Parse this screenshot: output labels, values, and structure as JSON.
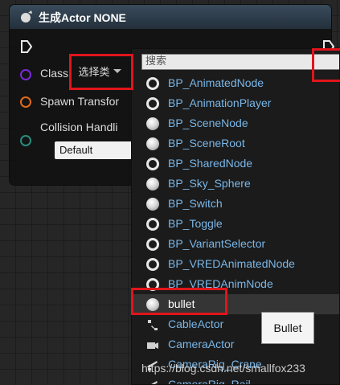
{
  "node": {
    "title": "生成Actor NONE",
    "pins": {
      "class_label": "Class",
      "class_combo_value": "选择类",
      "spawn_transform_label": "Spawn Transfor",
      "collision_label": "Collision Handli",
      "collision_value": "Default"
    }
  },
  "picker": {
    "search_placeholder": "搜索",
    "items": [
      {
        "label": "BP_AnimatedNode",
        "icon": "ring-icon"
      },
      {
        "label": "BP_AnimationPlayer",
        "icon": "ring-icon"
      },
      {
        "label": "BP_SceneNode",
        "icon": "ball-icon"
      },
      {
        "label": "BP_SceneRoot",
        "icon": "ball-icon"
      },
      {
        "label": "BP_SharedNode",
        "icon": "ring-icon"
      },
      {
        "label": "BP_Sky_Sphere",
        "icon": "ball-icon"
      },
      {
        "label": "BP_Switch",
        "icon": "ball-icon"
      },
      {
        "label": "BP_Toggle",
        "icon": "ring-icon"
      },
      {
        "label": "BP_VariantSelector",
        "icon": "ring-icon"
      },
      {
        "label": "BP_VREDAnimatedNode",
        "icon": "ring-icon"
      },
      {
        "label": "BP_VREDAnimNode",
        "icon": "ring-icon"
      },
      {
        "label": "bullet",
        "icon": "ball-icon",
        "selected": true
      },
      {
        "label": "CableActor",
        "icon": "cable-icon"
      },
      {
        "label": "CameraActor",
        "icon": "camera-icon"
      },
      {
        "label": "CameraRig_Crane",
        "icon": "crane-icon"
      },
      {
        "label": "CameraRig_Rail",
        "icon": "rail-icon"
      }
    ]
  },
  "tooltip": "Bullet",
  "watermark": "https://blog.csdn.net/smallfox233",
  "colors": {
    "highlight": "#e0151b",
    "list_text": "#7ab7e8",
    "class_pin": "#7a2bd6",
    "spawn_pin": "#e06a1b",
    "collision_pin": "#2a8b7c"
  }
}
